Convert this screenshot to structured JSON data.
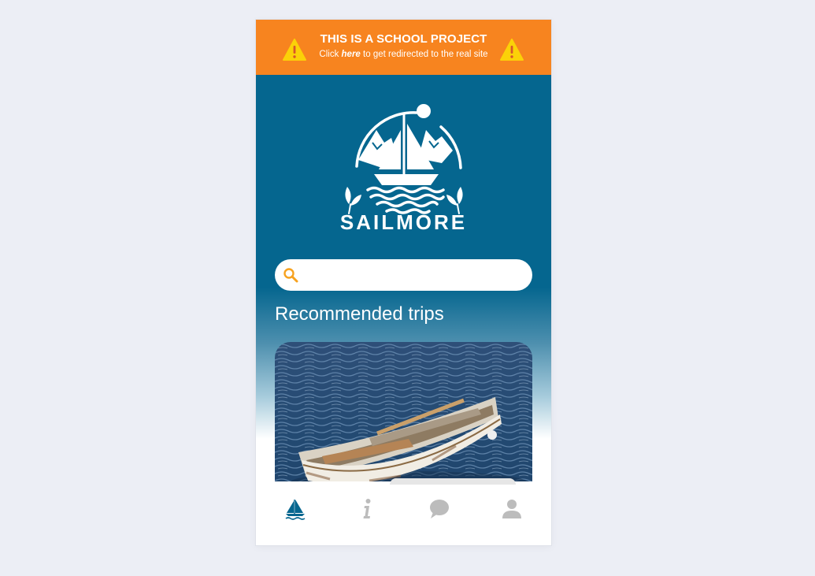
{
  "banner": {
    "title": "THIS IS A SCHOOL PROJECT",
    "sub_prefix": "Click",
    "link_text": "here",
    "sub_suffix": "to get redirected to the real site",
    "warning_icon": "warning-icon"
  },
  "brand": {
    "name": "SAILMORE",
    "logo_icon": "sailboat-logo"
  },
  "search": {
    "value": "",
    "placeholder": "",
    "icon": "search-icon"
  },
  "recommended": {
    "title": "Recommended trips",
    "cards": [
      {
        "image": "rowboat-on-water"
      }
    ]
  },
  "nav": {
    "items": [
      {
        "icon": "sailboat-icon",
        "active": true
      },
      {
        "icon": "info-icon",
        "active": false
      },
      {
        "icon": "chat-icon",
        "active": false
      },
      {
        "icon": "user-icon",
        "active": false
      }
    ]
  },
  "colors": {
    "banner": "#f7841f",
    "primary": "#05668f",
    "page_background": "#eceef5",
    "nav_active": "#05668f",
    "nav_inactive": "#bcbcbc",
    "search_icon": "#f7a21f"
  }
}
